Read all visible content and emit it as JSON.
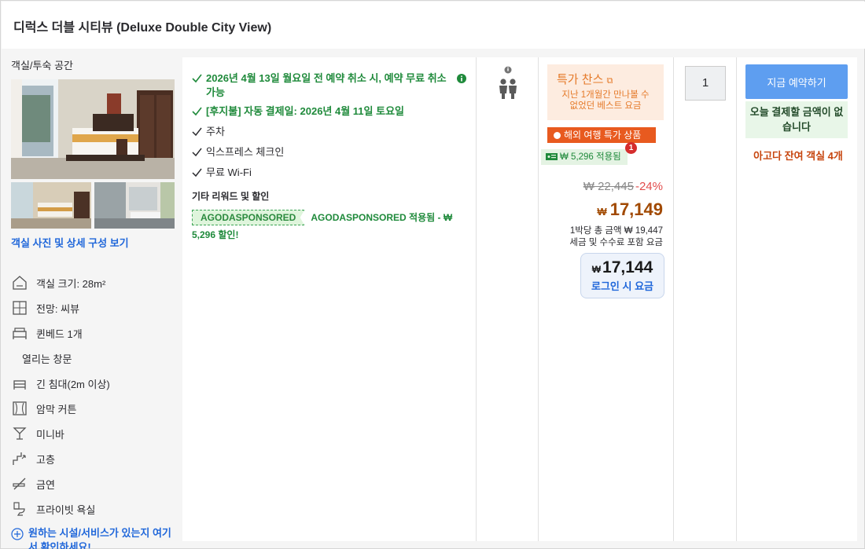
{
  "header": {
    "title": "디럭스 더블 시티뷰 (Deluxe Double City View)"
  },
  "room": {
    "section_title": "객실/투숙 공간",
    "view_link": "객실 사진 및 상세 구성 보기",
    "amenities": [
      {
        "icon": "room-size-icon",
        "label": "객실 크기: 28m²"
      },
      {
        "icon": "window-view-icon",
        "label": "전망: 씨뷰"
      },
      {
        "icon": "bed-icon",
        "label": "퀸베드 1개"
      },
      {
        "icon": "",
        "label": "열리는 창문"
      },
      {
        "icon": "long-bed-icon",
        "label": "긴 침대(2m 이상)"
      },
      {
        "icon": "curtain-icon",
        "label": "암막 커튼"
      },
      {
        "icon": "minibar-icon",
        "label": "미니바"
      },
      {
        "icon": "high-floor-icon",
        "label": "고층"
      },
      {
        "icon": "no-smoking-icon",
        "label": "금연"
      },
      {
        "icon": "toilet-icon",
        "label": "프라이빗 욕실"
      }
    ],
    "more_link": "원하는 시설/서비스가 있는지 여기서 확인하세요!"
  },
  "benefits": {
    "cancel": "2026년 4월 13일 월요일 전 예약 취소 시, 예약 무료 취소 가능",
    "pay_later": "[후지불] 자동 결제일: 2026년 4월 11일 토요일",
    "parking": "주차",
    "express": "익스프레스 체크인",
    "wifi": "무료 Wi-Fi",
    "other_title": "기타 리워드 및 할인",
    "promo_tag": "AGODASPONSORED",
    "promo_text": "AGODASPONSORED 적용됨 - ₩ 5,296 할인!"
  },
  "occupancy": {
    "guests": 2
  },
  "price": {
    "deal_title": "특가 찬스",
    "deal_subtitle": "지난 1개월간 만나볼 수 없었던 베스트 요금",
    "oversea_label": "해외 여행 특가 상품",
    "coupon_label": "₩ 5,296 적용됨",
    "coupon_badge": "1",
    "original": "₩ 22,445",
    "discount": "-24%",
    "currency": "₩",
    "current": "17,149",
    "total_line1": "1박당 총 금액 ₩ 19,447",
    "total_line2": "세금 및 수수료 포함 요금",
    "login_price": "17,144",
    "login_label": "로그인 시 요금"
  },
  "quantity": {
    "value": "1"
  },
  "booking": {
    "button_label": "지금 예약하기",
    "no_pay_text": "오늘 결제할 금액이 없습니다",
    "rooms_left": "아고다 잔여 객실 4개"
  },
  "colors": {
    "accent_blue": "#2067da",
    "book_button": "#5e9ef0",
    "price_brown": "#a14900",
    "green": "#1f8a3b",
    "deal_orange": "#e57a2a",
    "oversea_red": "#e85a1f"
  }
}
